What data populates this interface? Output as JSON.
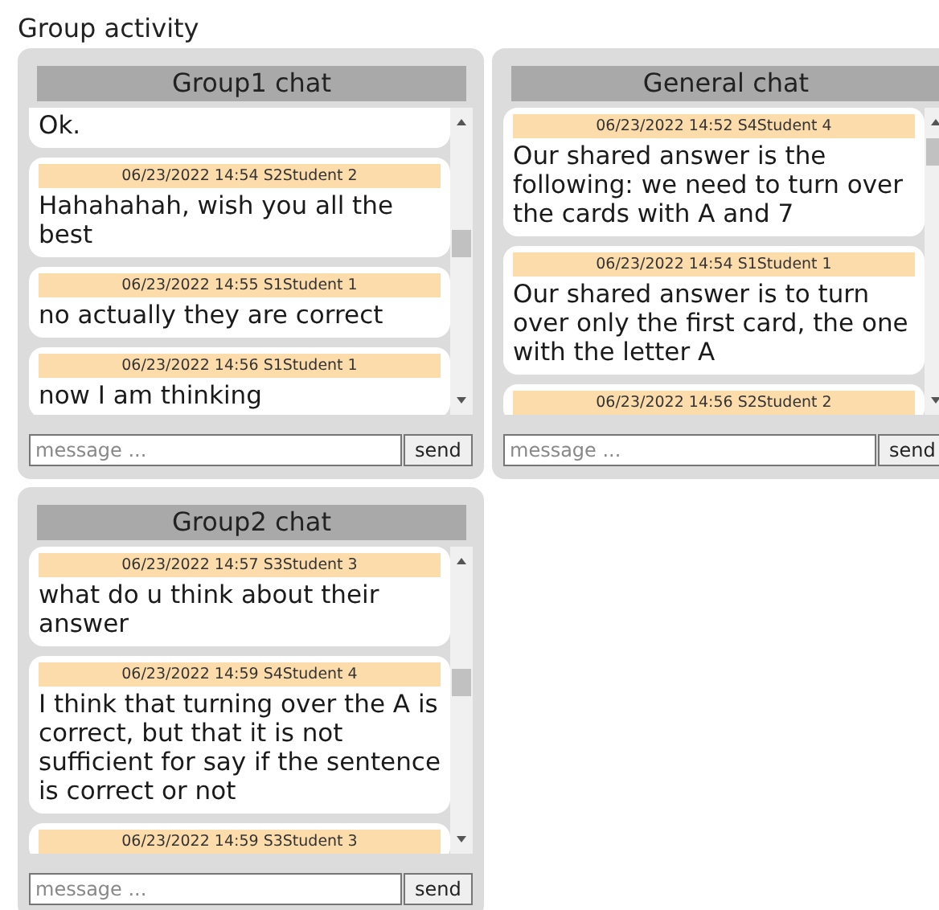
{
  "title": "Group activity",
  "chats": [
    {
      "title": "Group1 chat",
      "messages": [
        {
          "text": "Ok."
        },
        {
          "header": "06/23/2022 14:54 S2Student 2",
          "text": "Hahahahah, wish you all the best"
        },
        {
          "header": "06/23/2022 14:55 S1Student 1",
          "text": "no actually they are correct"
        },
        {
          "header": "06/23/2022 14:56 S1Student 1",
          "text": "now I am thinking"
        }
      ],
      "placeholder": "message ...",
      "send": "send"
    },
    {
      "title": "General chat",
      "messages": [
        {
          "header": "06/23/2022 14:52 S4Student 4",
          "text": "Our shared answer is the following: we need to turn over the cards with A and 7"
        },
        {
          "header": "06/23/2022 14:54 S1Student 1",
          "text": "Our shared answer is to turn over only the first card, the one with the letter A"
        },
        {
          "header": "06/23/2022 14:56 S2Student 2"
        }
      ],
      "placeholder": "message ...",
      "send": "send"
    },
    {
      "title": "Group2 chat",
      "messages": [
        {
          "header": "06/23/2022 14:57 S3Student 3",
          "text": "what do u think about their answer"
        },
        {
          "header": "06/23/2022 14:59 S4Student 4",
          "text": "I think that turning over the A is correct, but that it is not sufficient for say if the sentence is correct or not"
        },
        {
          "header": "06/23/2022 14:59 S3Student 3"
        }
      ],
      "placeholder": "message ...",
      "send": "send"
    }
  ]
}
